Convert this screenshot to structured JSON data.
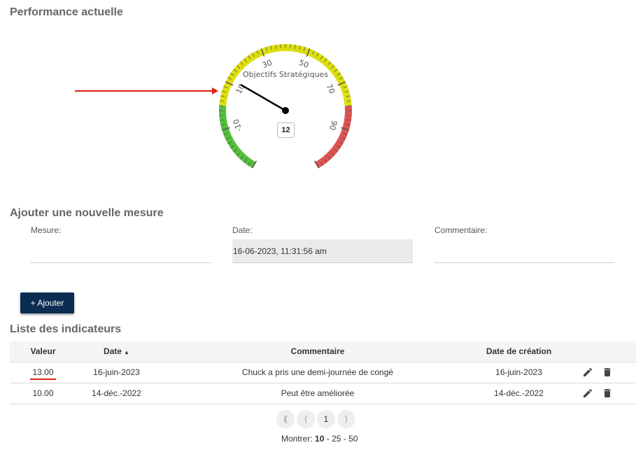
{
  "sections": {
    "performance_title": "Performance actuelle",
    "add_title": "Ajouter une nouvelle mesure",
    "list_title": "Liste des indicateurs"
  },
  "gauge": {
    "title": "Objectifs Stratégiques",
    "value": 12,
    "value_label": "12",
    "min": -30,
    "max": 110,
    "tick_labels": [
      "-10",
      "10",
      "30",
      "50",
      "70",
      "90"
    ],
    "tick_values": [
      -10,
      10,
      30,
      50,
      70,
      90
    ],
    "bands": [
      {
        "from": -30,
        "to": 0,
        "color": "#55bf3b"
      },
      {
        "from": 0,
        "to": 80,
        "color": "#dddf0d"
      },
      {
        "from": 80,
        "to": 110,
        "color": "#df5353"
      }
    ]
  },
  "form": {
    "mesure_label": "Mesure:",
    "mesure_value": "",
    "date_label": "Date:",
    "date_value": "16-06-2023, 11:31:56 am",
    "comment_label": "Commentaire:",
    "comment_value": "",
    "add_button": "+ Ajouter"
  },
  "table": {
    "headers": {
      "value": "Valeur",
      "date": "Date",
      "comment": "Commentaire",
      "created": "Date de création"
    },
    "sort_indicator": "▲",
    "rows": [
      {
        "value": "13.00",
        "date": "16-juin-2023",
        "comment": "Chuck a pris une demi-journée de congé",
        "created": "16-juin-2023"
      },
      {
        "value": "10.00",
        "date": "14-déc.-2022",
        "comment": "Peut être améliorée",
        "created": "14-déc.-2022"
      }
    ]
  },
  "pagination": {
    "first": "⟪",
    "prev": "⟨",
    "current": "1",
    "next": "⟩",
    "show_label": "Montrer:",
    "size_selected": "10",
    "size_sep1": " - ",
    "size_2": "25",
    "size_sep2": " - ",
    "size_3": "50"
  },
  "colors": {
    "annotation_arrow": "#e0200d",
    "primary_button": "#0c2d52"
  },
  "icons": {
    "edit": "pencil-icon",
    "delete": "trash-icon"
  }
}
